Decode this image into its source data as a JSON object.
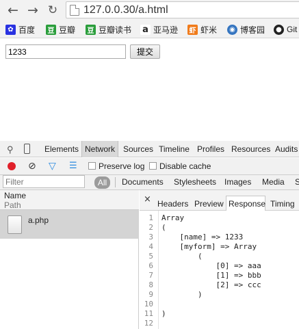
{
  "browser": {
    "url": "127.0.0.30/a.html",
    "bookmarks": [
      {
        "label": "百度",
        "icon": "baidu-icon",
        "color": "#2932e1"
      },
      {
        "label": "豆瓣",
        "icon": "douban-icon",
        "color": "#2b9e3c"
      },
      {
        "label": "豆瓣读书",
        "icon": "douban-icon",
        "color": "#2b9e3c"
      },
      {
        "label": "亚马逊",
        "icon": "amazon-icon",
        "color": "#222222"
      },
      {
        "label": "虾米",
        "icon": "xiami-icon",
        "color": "#f07b1b"
      },
      {
        "label": "博客园",
        "icon": "cnblogs-icon",
        "color": "#3575c0"
      },
      {
        "label": "Git",
        "icon": "github-icon",
        "color": "#222222"
      }
    ]
  },
  "form": {
    "input_value": "1233",
    "submit_label": "提交"
  },
  "devtools": {
    "tabs": [
      "Elements",
      "Network",
      "Sources",
      "Timeline",
      "Profiles",
      "Resources",
      "Audits"
    ],
    "active_tab": "Network",
    "toolbar": {
      "preserve_log": "Preserve log",
      "disable_cache": "Disable cache"
    },
    "filter": {
      "placeholder": "Filter",
      "types": [
        "All",
        "Documents",
        "Stylesheets",
        "Images",
        "Media",
        "S"
      ]
    },
    "list": {
      "header_name": "Name",
      "header_path": "Path",
      "items": [
        {
          "name": "a.php"
        }
      ]
    },
    "detail_tabs": [
      "Headers",
      "Preview",
      "Response",
      "Timing"
    ],
    "active_detail_tab": "Response",
    "response_lines": [
      "Array",
      "(",
      "    [name] => 1233",
      "    [myform] => Array",
      "        (",
      "            [0] => aaa",
      "            [1] => bbb",
      "            [2] => ccc",
      "        )",
      "",
      ")",
      ""
    ]
  }
}
